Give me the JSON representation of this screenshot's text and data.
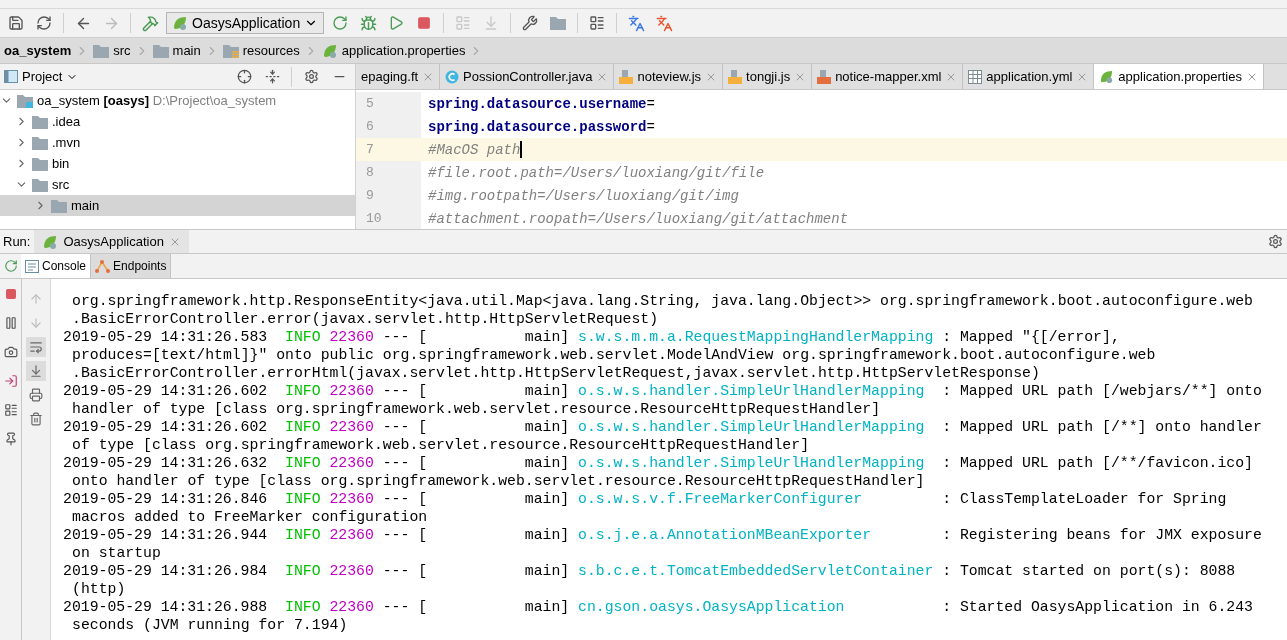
{
  "toolbar": {
    "run_configuration": "OasysApplication"
  },
  "breadcrumbs": [
    {
      "label": "oa_system",
      "kind": "project"
    },
    {
      "label": "src",
      "kind": "folder"
    },
    {
      "label": "main",
      "kind": "folder"
    },
    {
      "label": "resources",
      "kind": "resources"
    },
    {
      "label": "application.properties",
      "kind": "properties"
    }
  ],
  "project_panel": {
    "title": "Project",
    "tree": [
      {
        "label": "oa_system",
        "module": "[oasys]",
        "path": "D:\\Project\\oa_system",
        "kind": "module",
        "expanded": true,
        "selected": false,
        "children": [
          {
            "label": ".idea",
            "kind": "folder",
            "expanded": false,
            "selected": false
          },
          {
            "label": ".mvn",
            "kind": "folder",
            "expanded": false,
            "selected": false
          },
          {
            "label": "bin",
            "kind": "folder",
            "expanded": false,
            "selected": false
          },
          {
            "label": "src",
            "kind": "folder",
            "expanded": true,
            "selected": false,
            "children": [
              {
                "label": "main",
                "kind": "folder",
                "expanded": false,
                "selected": true
              }
            ]
          }
        ]
      }
    ]
  },
  "editor": {
    "tabs": [
      {
        "label": "epaging.ft",
        "kind": "ftl",
        "selected": false
      },
      {
        "label": "PossionController.java",
        "kind": "java",
        "selected": false
      },
      {
        "label": "noteview.js",
        "kind": "js",
        "selected": false
      },
      {
        "label": "tongji.js",
        "kind": "js",
        "selected": false
      },
      {
        "label": "notice-mapper.xml",
        "kind": "xml",
        "selected": false
      },
      {
        "label": "application.yml",
        "kind": "yml",
        "selected": false
      },
      {
        "label": "application.properties",
        "kind": "properties",
        "selected": true
      }
    ],
    "lines": [
      {
        "number": "5",
        "kind": "property",
        "key": "spring.datasource.username",
        "sign": "=",
        "current": false
      },
      {
        "number": "6",
        "kind": "property",
        "key": "spring.datasource.password",
        "sign": "=",
        "current": false
      },
      {
        "number": "7",
        "kind": "comment",
        "text": "#MacOS path",
        "current": true
      },
      {
        "number": "8",
        "kind": "comment",
        "text": "#file.root.path=/Users/luoxiang/git/file",
        "current": false
      },
      {
        "number": "9",
        "kind": "comment",
        "text": "#img.rootpath=/Users/luoxiang/git/img",
        "current": false
      },
      {
        "number": "10",
        "kind": "comment",
        "text": "#attachment.roopath=/Users/luoxiang/git/attachment",
        "current": false
      }
    ]
  },
  "run_panel": {
    "label": "Run:",
    "tabs": [
      {
        "label": "OasysApplication",
        "selected": true
      }
    ],
    "console_tabs": [
      {
        "label": "Console",
        "kind": "console",
        "selected": true
      },
      {
        "label": "Endpoints",
        "kind": "endpoints",
        "selected": false
      }
    ],
    "log": [
      {
        "kind": "continuation",
        "lines": [
          "org.springframework.http.ResponseEntity<java.util.Map<java.lang.String, java.lang.Object>> org.springframework.boot.autoconfigure.web",
          ".BasicErrorController.error(javax.servlet.http.HttpServletRequest)"
        ]
      },
      {
        "kind": "entry",
        "time": "2019-05-29 14:31:26.583",
        "level": "INFO",
        "pid": "22360",
        "dashes": "---",
        "thread": "[           main]",
        "logger": "s.w.s.m.m.a.RequestMappingHandlerMapping",
        "message": ": Mapped \"{[/error],",
        "lines": [
          "produces=[text/html]}\" onto public org.springframework.web.servlet.ModelAndView org.springframework.boot.autoconfigure.web",
          ".BasicErrorController.errorHtml(javax.servlet.http.HttpServletRequest,javax.servlet.http.HttpServletResponse)"
        ]
      },
      {
        "kind": "entry",
        "time": "2019-05-29 14:31:26.602",
        "level": "INFO",
        "pid": "22360",
        "dashes": "---",
        "thread": "[           main]",
        "logger": "o.s.w.s.handler.SimpleUrlHandlerMapping",
        "message": ": Mapped URL path [/webjars/**] onto",
        "lines": [
          "handler of type [class org.springframework.web.servlet.resource.ResourceHttpRequestHandler]"
        ]
      },
      {
        "kind": "entry",
        "time": "2019-05-29 14:31:26.602",
        "level": "INFO",
        "pid": "22360",
        "dashes": "---",
        "thread": "[           main]",
        "logger": "o.s.w.s.handler.SimpleUrlHandlerMapping",
        "message": ": Mapped URL path [/**] onto handler",
        "lines": [
          "of type [class org.springframework.web.servlet.resource.ResourceHttpRequestHandler]"
        ]
      },
      {
        "kind": "entry",
        "time": "2019-05-29 14:31:26.632",
        "level": "INFO",
        "pid": "22360",
        "dashes": "---",
        "thread": "[           main]",
        "logger": "o.s.w.s.handler.SimpleUrlHandlerMapping",
        "message": ": Mapped URL path [/**/favicon.ico]",
        "lines": [
          "onto handler of type [class org.springframework.web.servlet.resource.ResourceHttpRequestHandler]"
        ]
      },
      {
        "kind": "entry",
        "time": "2019-05-29 14:31:26.846",
        "level": "INFO",
        "pid": "22360",
        "dashes": "---",
        "thread": "[           main]",
        "logger": "o.s.w.s.v.f.FreeMarkerConfigurer",
        "message": ": ClassTemplateLoader for Spring",
        "lines": [
          "macros added to FreeMarker configuration"
        ]
      },
      {
        "kind": "entry",
        "time": "2019-05-29 14:31:26.944",
        "level": "INFO",
        "pid": "22360",
        "dashes": "---",
        "thread": "[           main]",
        "logger": "o.s.j.e.a.AnnotationMBeanExporter",
        "message": ": Registering beans for JMX exposure",
        "lines": [
          "on startup"
        ]
      },
      {
        "kind": "entry",
        "time": "2019-05-29 14:31:26.984",
        "level": "INFO",
        "pid": "22360",
        "dashes": "---",
        "thread": "[           main]",
        "logger": "s.b.c.e.t.TomcatEmbeddedServletContainer",
        "message": ": Tomcat started on port(s): 8088",
        "lines": [
          "(http)"
        ]
      },
      {
        "kind": "entry",
        "time": "2019-05-29 14:31:26.988",
        "level": "INFO",
        "pid": "22360",
        "dashes": "---",
        "thread": "[           main]",
        "logger": "cn.gson.oasys.OasysApplication",
        "message": ": Started OasysApplication in 6.243",
        "lines": [
          "seconds (JVM running for 7.194)"
        ]
      }
    ]
  }
}
